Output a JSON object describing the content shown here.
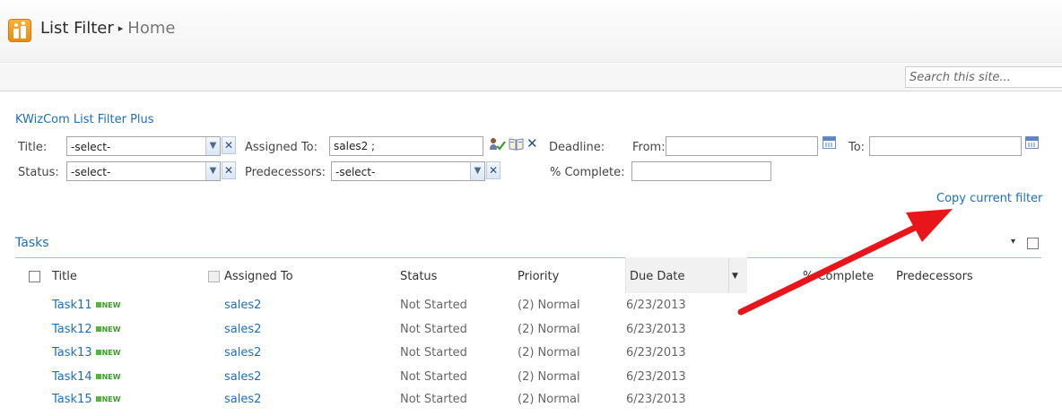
{
  "header": {
    "site_title": "List Filter",
    "current_page": "Home",
    "separator": "▸"
  },
  "search": {
    "placeholder": "Search this site..."
  },
  "filter": {
    "title": "KWizCom List Filter Plus",
    "title_label": "Title:",
    "title_value": "-select-",
    "status_label": "Status:",
    "status_value": "-select-",
    "assigned_label": "Assigned To:",
    "assigned_value": "sales2 ;",
    "predecessors_label": "Predecessors:",
    "predecessors_value": "-select-",
    "deadline_label": "Deadline:",
    "from_label": "From:",
    "to_label": "To:",
    "complete_label": "% Complete:",
    "clear_glyph": "✕",
    "copy_link": "Copy current filter"
  },
  "tasks": {
    "title": "Tasks",
    "menu_glyph": "▾",
    "columns": [
      "Title",
      "Assigned To",
      "Status",
      "Priority",
      "Due Date",
      "% Complete",
      "Predecessors"
    ],
    "new_label": "NEW",
    "rows": [
      {
        "title": "Task11",
        "assigned": "sales2",
        "status": "Not Started",
        "priority": "(2) Normal",
        "due": "6/23/2013"
      },
      {
        "title": "Task12",
        "assigned": "sales2",
        "status": "Not Started",
        "priority": "(2) Normal",
        "due": "6/23/2013"
      },
      {
        "title": "Task13",
        "assigned": "sales2",
        "status": "Not Started",
        "priority": "(2) Normal",
        "due": "6/23/2013"
      },
      {
        "title": "Task14",
        "assigned": "sales2",
        "status": "Not Started",
        "priority": "(2) Normal",
        "due": "6/23/2013"
      },
      {
        "title": "Task15",
        "assigned": "sales2",
        "status": "Not Started",
        "priority": "(2) Normal",
        "due": "6/23/2013"
      }
    ]
  },
  "colors": {
    "link": "#1e6fb8",
    "annotation_arrow": "#e8161b",
    "accent_orange": "#f0950f"
  },
  "icons": [
    "site-logo-icon",
    "check-names-icon",
    "address-book-icon",
    "calendar-icon",
    "dropdown-arrow-icon",
    "clear-icon"
  ]
}
